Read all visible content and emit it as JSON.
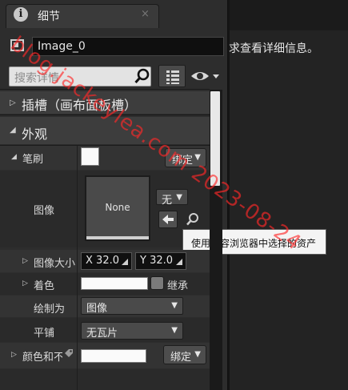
{
  "tab": {
    "title": "细节",
    "close": "×"
  },
  "background_hint": "求查看详细信息。",
  "object": {
    "name": "Image_0"
  },
  "search": {
    "placeholder": "搜索详情"
  },
  "categories": [
    {
      "label": "插槽（画布面板槽）",
      "expanded": false
    },
    {
      "label": "外观",
      "expanded": true
    }
  ],
  "brush": {
    "label": "笔刷",
    "bind_label": "绑定",
    "image_label": "图像",
    "thumbnail_text": "None",
    "asset_combo": "无",
    "tooltip": "使用内容浏览器中选择的资产",
    "image_size_label": "图像大小",
    "size_x_prefix": "X",
    "size_x": "32.0",
    "size_y_prefix": "Y",
    "size_y": "32.0",
    "tint_label": "着色",
    "inherit_label": "继承",
    "draw_as_label": "绘制为",
    "draw_as_value": "图像",
    "tiling_label": "平铺",
    "tiling_value": "无瓦片"
  },
  "color_row": {
    "label": "颜色和不",
    "bind_label": "绑定"
  },
  "watermark": "blog.jackeylea.com  2023-08-24"
}
